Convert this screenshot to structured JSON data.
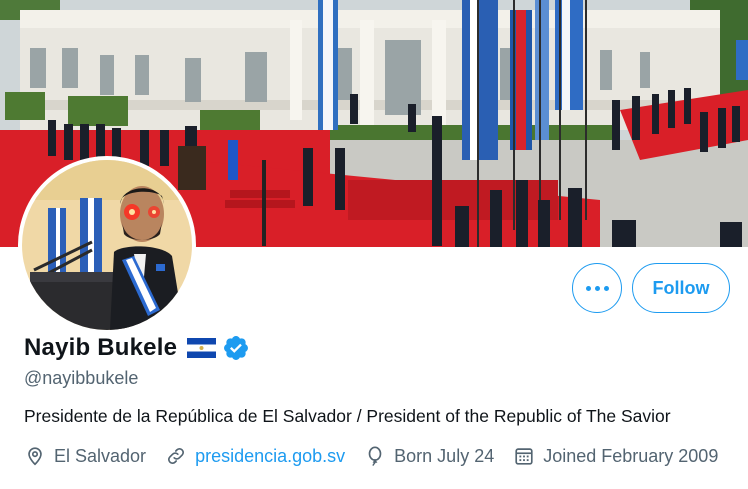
{
  "profile": {
    "name": "Nayib Bukele",
    "handle": "@nayibbukele",
    "bio": "Presidente de la República de El Salvador / President of the Republic of The Savior",
    "verified_icon": "verified-badge-icon",
    "flag_icon": "el-salvador-flag-icon"
  },
  "meta": {
    "location": "El Salvador",
    "website": "presidencia.gob.sv",
    "birthday": "Born July 24",
    "joined": "Joined February 2009"
  },
  "actions": {
    "more_icon": "more-dots-icon",
    "follow_label": "Follow"
  },
  "colors": {
    "accent": "#1d9bf0",
    "muted_text": "#536471",
    "primary_text": "#0f1419",
    "flag_blue": "#0f47af"
  }
}
